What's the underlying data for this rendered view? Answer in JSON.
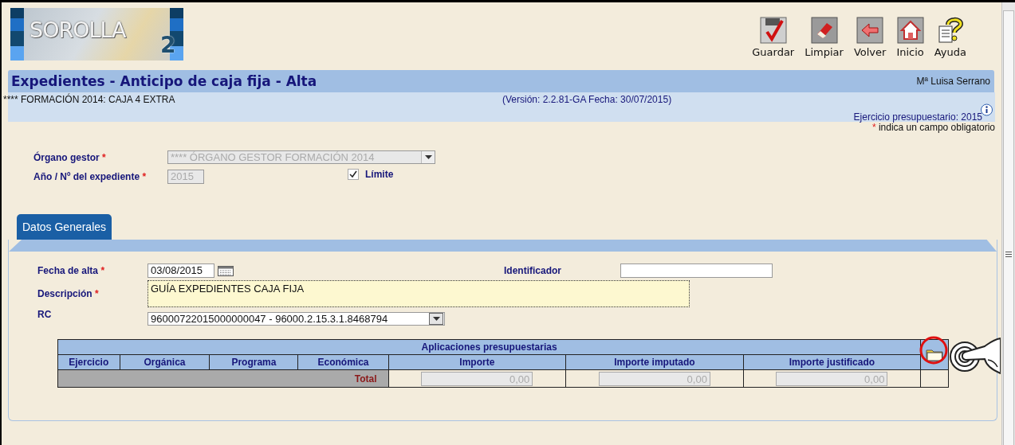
{
  "logo": {
    "name": "SOROLLA",
    "mark": "2"
  },
  "toolbar": [
    {
      "kind": "save",
      "label": "Guardar"
    },
    {
      "kind": "clear",
      "label": "Limpiar"
    },
    {
      "kind": "back",
      "label": "Volver"
    },
    {
      "kind": "home",
      "label": "Inicio"
    },
    {
      "kind": "help",
      "label": "Ayuda"
    }
  ],
  "header": {
    "title": "Expedientes - Anticipo de caja fija - Alta",
    "user": "Mª Luisa Serrano",
    "subtitle": "**** FORMACIÓN 2014: CAJA 4 EXTRA",
    "version": "(Versión: 2.2.81-GA Fecha: 30/07/2015)",
    "fiscal_year": "Ejercicio presupuestario: 2015",
    "required_mark": "*",
    "required_note": "indica un campo obligatorio"
  },
  "top_fields": [
    {
      "kind": "select",
      "label": "Órgano gestor",
      "required_mark": "*",
      "value": "**** ÓRGANO GESTOR FORMACIÓN 2014",
      "disabled": true
    },
    {
      "kind": "text",
      "label": "Año / Nº del expediente",
      "required_mark": "*",
      "value": "2015",
      "disabled": true
    }
  ],
  "limit_checkbox": {
    "label": "Límite",
    "checked": true
  },
  "tabs": [
    {
      "label": "Datos Generales",
      "selected": true
    }
  ],
  "form": {
    "fecha_alta": {
      "label": "Fecha de alta",
      "required_mark": "*",
      "value": "03/08/2015"
    },
    "identificador": {
      "label": "Identificador"
    },
    "descripcion": {
      "label": "Descripción",
      "required_mark": "*",
      "value": "GUÍA EXPEDIENTES CAJA FIJA"
    },
    "rc": {
      "label": "RC",
      "value": "96000722015000000047 - 96000.2.15.3.1.8468794"
    }
  },
  "table": {
    "title": "Aplicaciones presupuestarias",
    "columns": [
      "Ejercicio",
      "Orgánica",
      "Programa",
      "Económica",
      "Importe",
      "Importe imputado",
      "Importe justificado"
    ],
    "total_label": "Total",
    "totals": [
      "0,00",
      "0,00",
      "0,00"
    ]
  }
}
